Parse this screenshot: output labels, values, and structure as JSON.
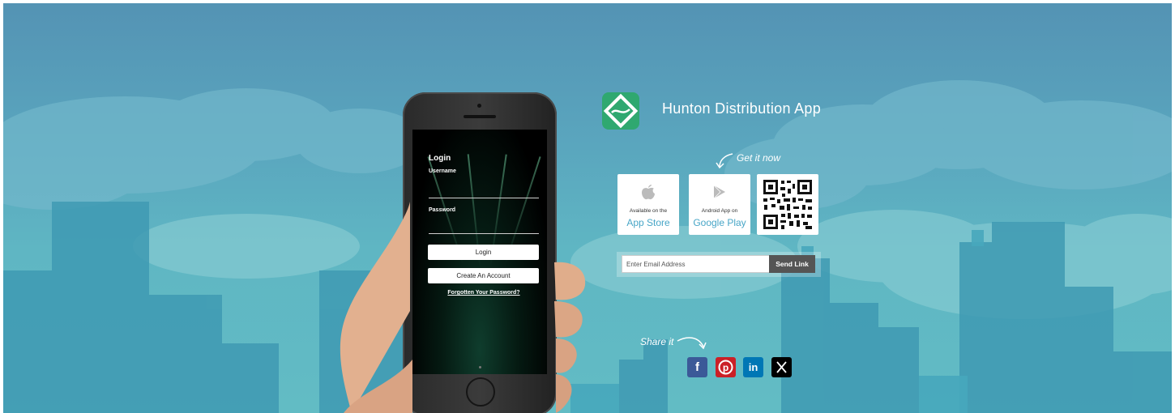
{
  "colors": {
    "sky_top": "#5493b4",
    "sky_bottom": "#62bcc4",
    "brand_green": "#2fa870",
    "store_link_blue": "#48a6c7",
    "send_button": "#555555",
    "facebook": "#3b5998",
    "pinterest": "#cb2027",
    "linkedin": "#0077b5",
    "x": "#000000"
  },
  "phone_screen": {
    "title": "Login",
    "username_label": "Username",
    "password_label": "Password",
    "login_button": "Login",
    "create_account_button": "Create An Account",
    "forgot_link": "Forgotten Your Password?"
  },
  "app": {
    "logo_icon": "hunton-logo-icon",
    "title": "Hunton Distribution App"
  },
  "download": {
    "get_it_now": "Get it now",
    "app_store": {
      "small": "Available on the",
      "big": "App Store",
      "icon": "apple-icon"
    },
    "google_play": {
      "small": "Android App on",
      "big": "Google Play",
      "icon": "play-icon"
    },
    "qr_icon": "qr-code-icon"
  },
  "email_form": {
    "placeholder": "Enter Email Address",
    "value": "",
    "button": "Send Link"
  },
  "share": {
    "label": "Share it",
    "icons": [
      "facebook-icon",
      "pinterest-icon",
      "linkedin-icon",
      "x-icon"
    ]
  }
}
